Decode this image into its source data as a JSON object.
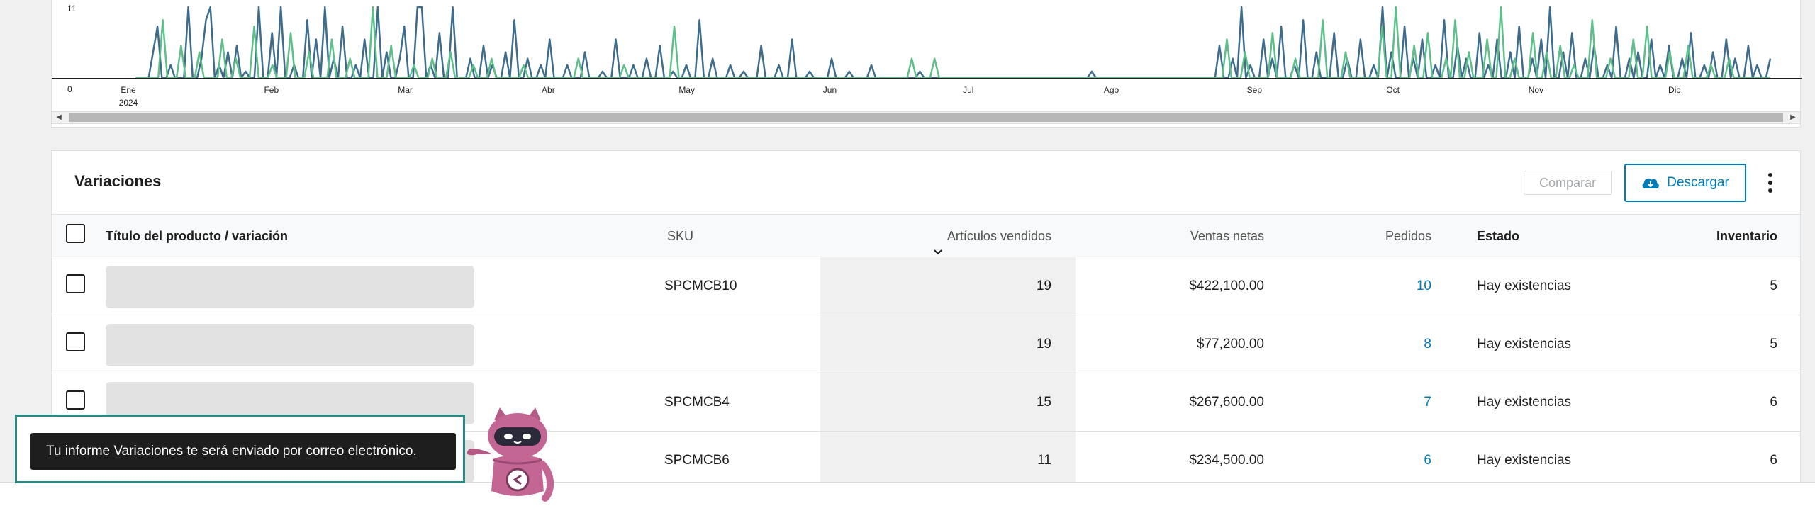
{
  "chart": {
    "y_ticks": [
      "11",
      "0"
    ],
    "x_ticks": [
      "Ene",
      "Feb",
      "Mar",
      "Abr",
      "May",
      "Jun",
      "Jul",
      "Ago",
      "Sep",
      "Oct",
      "Nov",
      "Dic"
    ],
    "year_label": "2024",
    "colors": {
      "series_dark": "#3e6c8c",
      "series_green": "#5ebf8a"
    }
  },
  "chart_data": {
    "type": "line",
    "x_start": "2024-01-01",
    "x_end": "2024-12-31",
    "y_ticks": [
      0,
      11
    ],
    "series": [
      {
        "color": "#3e6c8c",
        "values": [
          0,
          0,
          0,
          0,
          4,
          8,
          0,
          0,
          2,
          0,
          0,
          0,
          11,
          0,
          0,
          3,
          9,
          11,
          0,
          2,
          0,
          4,
          0,
          5,
          0,
          1,
          0,
          0,
          11,
          0,
          0,
          7,
          0,
          11,
          0,
          0,
          2,
          0,
          0,
          9,
          0,
          6,
          0,
          11,
          0,
          3,
          0,
          8,
          0,
          0,
          2,
          0,
          6,
          0,
          0,
          11,
          0,
          4,
          0,
          0,
          3,
          8,
          0,
          0,
          11,
          11,
          0,
          2,
          0,
          7,
          0,
          0,
          11,
          0,
          0,
          0,
          3,
          0,
          0,
          5,
          0,
          2,
          0,
          0,
          4,
          0,
          9,
          0,
          0,
          3,
          0,
          0,
          2,
          0,
          6,
          0,
          0,
          0,
          2,
          0,
          0,
          0,
          4,
          0,
          0,
          0,
          1,
          0,
          0,
          6,
          0,
          0,
          0,
          2,
          0,
          0,
          3,
          0,
          0,
          5,
          0,
          0,
          1,
          0,
          0,
          2,
          0,
          0,
          9,
          0,
          0,
          3,
          0,
          0,
          0,
          2,
          0,
          0,
          1,
          0,
          0,
          0,
          5,
          0,
          0,
          0,
          2,
          0,
          0,
          6,
          0,
          0,
          0,
          1,
          0,
          0,
          0,
          0,
          3,
          0,
          0,
          0,
          1,
          0,
          0,
          0,
          0,
          2,
          0,
          0,
          0,
          0,
          0,
          0,
          0,
          0,
          0,
          0,
          1,
          0,
          0,
          0,
          0,
          0,
          0,
          0,
          0,
          0,
          0,
          0,
          0,
          0,
          0,
          0,
          0,
          0,
          0,
          0,
          0,
          0,
          0,
          0,
          0,
          0,
          0,
          0,
          0,
          0,
          0,
          0,
          0,
          0,
          0,
          0,
          0,
          0,
          0,
          1,
          0,
          0,
          0,
          0,
          0,
          0,
          0,
          0,
          0,
          0,
          0,
          0,
          0,
          0,
          0,
          0,
          0,
          0,
          0,
          0,
          0,
          0,
          0,
          0,
          0,
          0,
          0,
          0,
          5,
          0,
          0,
          3,
          0,
          11,
          0,
          2,
          0,
          0,
          6,
          0,
          3,
          0,
          8,
          0,
          0,
          2,
          0,
          9,
          0,
          0,
          4,
          0,
          0,
          0,
          7,
          0,
          0,
          3,
          0,
          0,
          6,
          0,
          0,
          2,
          0,
          11,
          0,
          4,
          0,
          0,
          8,
          0,
          3,
          0,
          6,
          0,
          0,
          2,
          0,
          9,
          0,
          0,
          5,
          0,
          3,
          0,
          0,
          7,
          0,
          2,
          0,
          6,
          0,
          0,
          4,
          0,
          8,
          0,
          0,
          3,
          0,
          6,
          0,
          11,
          0,
          0,
          4,
          0,
          7,
          0,
          0,
          3,
          0,
          5,
          0,
          0,
          2,
          0,
          8,
          0,
          0,
          3,
          0,
          4,
          0,
          0,
          6,
          0,
          2,
          0,
          5,
          0,
          0,
          3,
          0,
          7,
          0,
          0,
          2,
          0,
          4,
          0,
          0,
          6,
          0,
          3,
          0,
          0,
          5,
          0,
          2,
          0,
          0,
          3
        ]
      },
      {
        "color": "#5ebf8a",
        "values": [
          0,
          0,
          0,
          0,
          0,
          0,
          9,
          0,
          0,
          0,
          5,
          0,
          0,
          0,
          4,
          0,
          0,
          0,
          0,
          6,
          0,
          0,
          3,
          0,
          0,
          0,
          8,
          0,
          0,
          0,
          2,
          0,
          0,
          0,
          7,
          0,
          0,
          0,
          4,
          0,
          0,
          0,
          0,
          6,
          0,
          0,
          0,
          3,
          0,
          0,
          0,
          0,
          11,
          0,
          0,
          0,
          5,
          0,
          0,
          0,
          0,
          2,
          0,
          0,
          0,
          3,
          0,
          0,
          0,
          4,
          0,
          0,
          0,
          0,
          2,
          0,
          0,
          0,
          3,
          0,
          0,
          0,
          0,
          0,
          0,
          2,
          0,
          0,
          0,
          0,
          0,
          0,
          0,
          0,
          0,
          0,
          0,
          3,
          0,
          0,
          0,
          0,
          0,
          0,
          0,
          0,
          0,
          2,
          0,
          0,
          0,
          0,
          0,
          0,
          0,
          0,
          0,
          0,
          8,
          0,
          0,
          0,
          0,
          0,
          0,
          0,
          0,
          0,
          0,
          0,
          0,
          0,
          0,
          0,
          0,
          0,
          0,
          0,
          0,
          0,
          0,
          0,
          0,
          0,
          0,
          0,
          0,
          0,
          0,
          0,
          0,
          0,
          0,
          0,
          0,
          0,
          0,
          0,
          0,
          0,
          0,
          0,
          0,
          0,
          0,
          0,
          0,
          0,
          0,
          0,
          3,
          0,
          0,
          0,
          0,
          3,
          0,
          0,
          0,
          0,
          0,
          0,
          0,
          0,
          0,
          0,
          0,
          0,
          0,
          0,
          0,
          0,
          0,
          0,
          0,
          0,
          0,
          0,
          0,
          0,
          0,
          0,
          0,
          0,
          0,
          0,
          0,
          0,
          0,
          0,
          0,
          0,
          0,
          0,
          0,
          0,
          0,
          0,
          0,
          0,
          0,
          0,
          0,
          0,
          0,
          0,
          0,
          0,
          0,
          0,
          0,
          0,
          0,
          0,
          0,
          0,
          0,
          0,
          0,
          6,
          0,
          0,
          0,
          4,
          0,
          0,
          0,
          0,
          0,
          7,
          0,
          0,
          0,
          0,
          3,
          0,
          0,
          0,
          0,
          0,
          9,
          0,
          0,
          0,
          0,
          4,
          0,
          0,
          0,
          0,
          0,
          0,
          0,
          8,
          0,
          0,
          11,
          0,
          0,
          0,
          5,
          0,
          0,
          7,
          0,
          0,
          0,
          3,
          0,
          9,
          0,
          0,
          4,
          0,
          0,
          0,
          6,
          0,
          0,
          11,
          0,
          0,
          3,
          0,
          0,
          0,
          7,
          0,
          0,
          4,
          0,
          0,
          5,
          0,
          0,
          2,
          0,
          0,
          0,
          9,
          0,
          0,
          0,
          3,
          0,
          0,
          0,
          0,
          6,
          0,
          0,
          8,
          0,
          0,
          0,
          0,
          4,
          0,
          0,
          0,
          5,
          0,
          0,
          0,
          0,
          2,
          0,
          0,
          0,
          3,
          0,
          0,
          0,
          0,
          0,
          0,
          0,
          0,
          0
        ]
      }
    ],
    "ylim": [
      0,
      11
    ]
  },
  "table": {
    "title": "Variaciones",
    "compare_label": "Comparar",
    "download_label": "Descargar",
    "columns": {
      "product": "Título del producto / variación",
      "sku": "SKU",
      "sold": "Artículos vendidos",
      "net": "Ventas netas",
      "orders": "Pedidos",
      "status": "Estado",
      "inventory": "Inventario"
    },
    "rows": [
      {
        "sku": "SPCMCB10",
        "sold": "19",
        "net": "$422,100.00",
        "orders": "10",
        "status": "Hay existencias",
        "inventory": "5"
      },
      {
        "sku": "",
        "sold": "19",
        "net": "$77,200.00",
        "orders": "8",
        "status": "Hay existencias",
        "inventory": "5"
      },
      {
        "sku": "SPCMCB4",
        "sold": "15",
        "net": "$267,600.00",
        "orders": "7",
        "status": "Hay existencias",
        "inventory": "6"
      },
      {
        "sku": "SPCMCB6",
        "sold": "11",
        "net": "$234,500.00",
        "orders": "6",
        "status": "Hay existencias",
        "inventory": "6"
      }
    ]
  },
  "notice": {
    "text": "Tu informe Variaciones te será enviado por correo electrónico."
  },
  "icons": {
    "download": "cloud-download-icon",
    "more": "kebab-menu-icon",
    "sort": "chevron-down-icon"
  }
}
